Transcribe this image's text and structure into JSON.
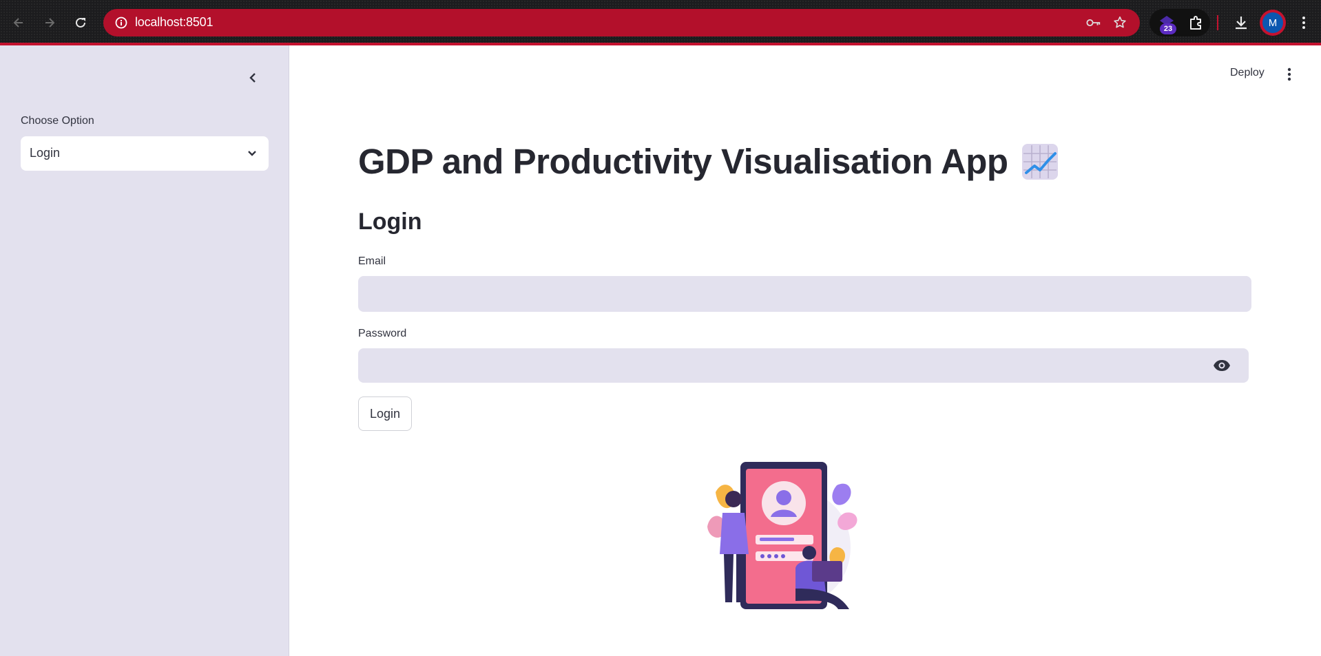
{
  "browser": {
    "url": "localhost:8501",
    "extensions_badge": "23",
    "profile_initial": "M",
    "accent_color": "#c4122f"
  },
  "sidebar": {
    "select_label": "Choose Option",
    "select_value": "Login"
  },
  "header": {
    "deploy_label": "Deploy"
  },
  "main": {
    "title": "GDP and Productivity Visualisation App",
    "title_icon": "chart-increasing-icon",
    "subtitle": "Login",
    "email_label": "Email",
    "email_value": "",
    "password_label": "Password",
    "password_value": "",
    "login_button": "Login",
    "illustration": "mobile-login-illustration"
  }
}
